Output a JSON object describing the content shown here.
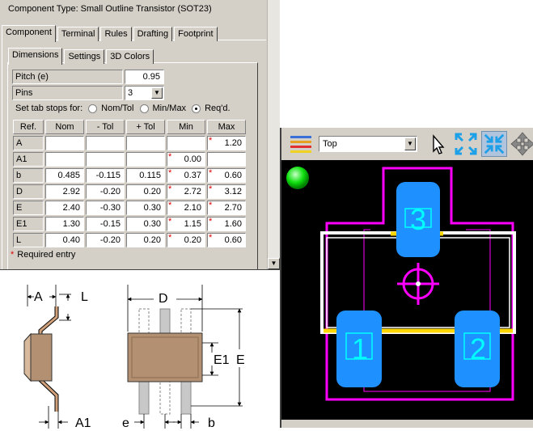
{
  "dialog": {
    "component_type": "Component Type: Small Outline Transistor (SOT23)",
    "main_tabs": [
      "Component",
      "Terminal",
      "Rules",
      "Drafting",
      "Footprint"
    ],
    "sub_tabs": [
      "Dimensions",
      "Settings",
      "3D Colors"
    ],
    "pitch": {
      "label": "Pitch (e)",
      "value": "0.95"
    },
    "pins": {
      "label": "Pins",
      "value": "3"
    },
    "tab_stops": {
      "label": "Set tab stops for:",
      "options": [
        "Nom/Tol",
        "Min/Max",
        "Req'd."
      ],
      "selected": "Req'd."
    },
    "table": {
      "headers": [
        "Ref.",
        "Nom",
        "- Tol",
        "+ Tol",
        "Min",
        "Max"
      ],
      "rows": [
        {
          "ref": "A",
          "nom": "",
          "minus_tol": "",
          "plus_tol": "",
          "min": "",
          "max": "1.20",
          "min_required": false,
          "max_required": true
        },
        {
          "ref": "A1",
          "nom": "",
          "minus_tol": "",
          "plus_tol": "",
          "min": "0.00",
          "max": "",
          "min_required": true,
          "max_required": false
        },
        {
          "ref": "b",
          "nom": "0.485",
          "minus_tol": "-0.115",
          "plus_tol": "0.115",
          "min": "0.37",
          "max": "0.60",
          "min_required": true,
          "max_required": true
        },
        {
          "ref": "D",
          "nom": "2.92",
          "minus_tol": "-0.20",
          "plus_tol": "0.20",
          "min": "2.72",
          "max": "3.12",
          "min_required": true,
          "max_required": true
        },
        {
          "ref": "E",
          "nom": "2.40",
          "minus_tol": "-0.30",
          "plus_tol": "0.30",
          "min": "2.10",
          "max": "2.70",
          "min_required": true,
          "max_required": true
        },
        {
          "ref": "E1",
          "nom": "1.30",
          "minus_tol": "-0.15",
          "plus_tol": "0.30",
          "min": "1.15",
          "max": "1.60",
          "min_required": true,
          "max_required": true
        },
        {
          "ref": "L",
          "nom": "0.40",
          "minus_tol": "-0.20",
          "plus_tol": "0.20",
          "min": "0.20",
          "max": "0.60",
          "min_required": true,
          "max_required": true
        }
      ]
    },
    "required_note": "Required entry"
  },
  "drawing": {
    "labels": {
      "A": "A",
      "L": "L",
      "D": "D",
      "E1": "E1",
      "E": "E",
      "A1": "A1",
      "e": "e",
      "b": "b"
    }
  },
  "viewer": {
    "layer": "Top",
    "pads": [
      "1",
      "2",
      "3"
    ],
    "icons": [
      "layers-icon",
      "pointer-icon",
      "zoom-extents-icon",
      "zoom-fit-icon",
      "pan-icon",
      "status-led-icon"
    ],
    "colors": {
      "pad": "#1e90ff",
      "pad_label": "#00ffff",
      "courtyard": "#ff00ff",
      "silkscreen": "#ffffff",
      "assembly": "#ffd700",
      "led": "#00dd00"
    }
  }
}
